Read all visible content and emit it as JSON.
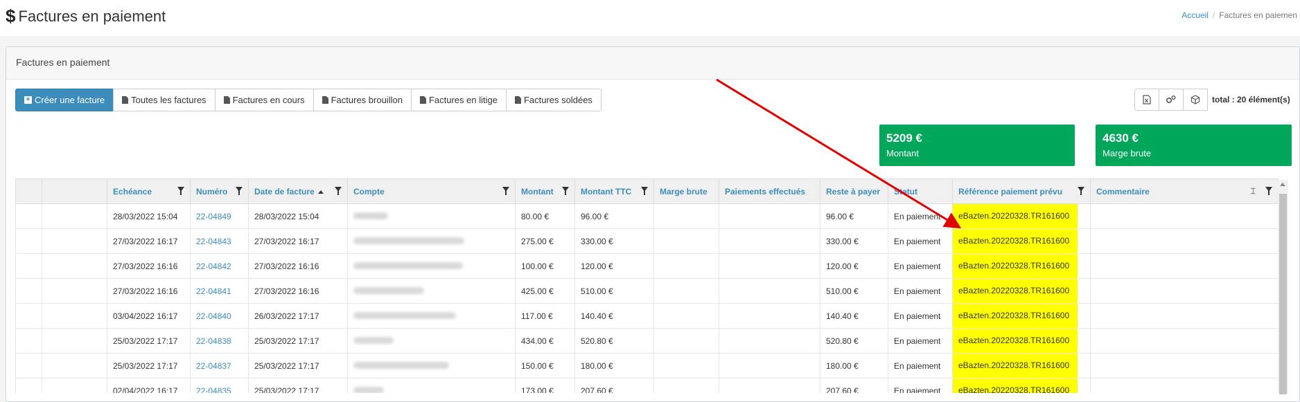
{
  "header": {
    "icon": "dollar-icon",
    "title": "Factures en paiement",
    "breadcrumb": {
      "home": "Accueil",
      "current": "Factures en paiemen"
    }
  },
  "box": {
    "title": "Factures en paiement"
  },
  "toolbar": {
    "create": "Créer une facture",
    "all": "Toutes les factures",
    "in_progress": "Factures en cours",
    "draft": "Factures brouillon",
    "dispute": "Factures en litige",
    "settled": "Factures soldées"
  },
  "right_tools": {
    "icons": [
      "excel-icon",
      "settings-icon",
      "cube-icon"
    ],
    "total": "total : 20 élément(s)"
  },
  "stats": [
    {
      "value": "5209 €",
      "label": "Montant"
    },
    {
      "value": "4630 €",
      "label": "Marge brute"
    }
  ],
  "table": {
    "columns": [
      "Echéance",
      "Numéro",
      "Date de facture",
      "Compte",
      "Montant",
      "Montant TTC",
      "Marge brute",
      "Paiements effectués",
      "Reste à payer",
      "Statut",
      "Référence paiement prévu",
      "Commentaire"
    ],
    "rows": [
      {
        "echeance": "28/03/2022 15:04",
        "numero": "22-04849",
        "date": "28/03/2022 15:04",
        "montant": "80.00 €",
        "ttc": "96.00 €",
        "reste": "96.00 €",
        "statut": "En paiement",
        "ref": "eBazten.20220328.TR161600"
      },
      {
        "echeance": "27/03/2022 16:17",
        "numero": "22-04843",
        "date": "27/03/2022 16:17",
        "montant": "275.00 €",
        "ttc": "330.00 €",
        "reste": "330.00 €",
        "statut": "En paiement",
        "ref": "eBazten.20220328.TR161600"
      },
      {
        "echeance": "27/03/2022 16:16",
        "numero": "22-04842",
        "date": "27/03/2022 16:16",
        "montant": "100.00 €",
        "ttc": "120.00 €",
        "reste": "120.00 €",
        "statut": "En paiement",
        "ref": "eBazten.20220328.TR161600"
      },
      {
        "echeance": "27/03/2022 16:16",
        "numero": "22-04841",
        "date": "27/03/2022 16:16",
        "montant": "425.00 €",
        "ttc": "510.00 €",
        "reste": "510.00 €",
        "statut": "En paiement",
        "ref": "eBazten.20220328.TR161600"
      },
      {
        "echeance": "03/04/2022 16:17",
        "numero": "22-04840",
        "date": "26/03/2022 17:17",
        "montant": "117.00 €",
        "ttc": "140.40 €",
        "reste": "140.40 €",
        "statut": "En paiement",
        "ref": "eBazten.20220328.TR161600"
      },
      {
        "echeance": "25/03/2022 17:17",
        "numero": "22-04838",
        "date": "25/03/2022 17:17",
        "montant": "434.00 €",
        "ttc": "520.80 €",
        "reste": "520.80 €",
        "statut": "En paiement",
        "ref": "eBazten.20220328.TR161600"
      },
      {
        "echeance": "25/03/2022 17:17",
        "numero": "22-04837",
        "date": "25/03/2022 17:17",
        "montant": "150.00 €",
        "ttc": "180.00 €",
        "reste": "180.00 €",
        "statut": "En paiement",
        "ref": "eBazten.20220328.TR161600"
      },
      {
        "echeance": "02/04/2022 16:17",
        "numero": "22-04835",
        "date": "25/03/2022 17:17",
        "montant": "173.00 €",
        "ttc": "207.60 €",
        "reste": "207.60 €",
        "statut": "En paiement",
        "ref": "eBazten.20220328.TR161600"
      }
    ]
  },
  "colors": {
    "accent": "#3c8dbc",
    "success": "#00a65a",
    "highlight": "#ffff00",
    "annotation_arrow": "#e00000"
  }
}
